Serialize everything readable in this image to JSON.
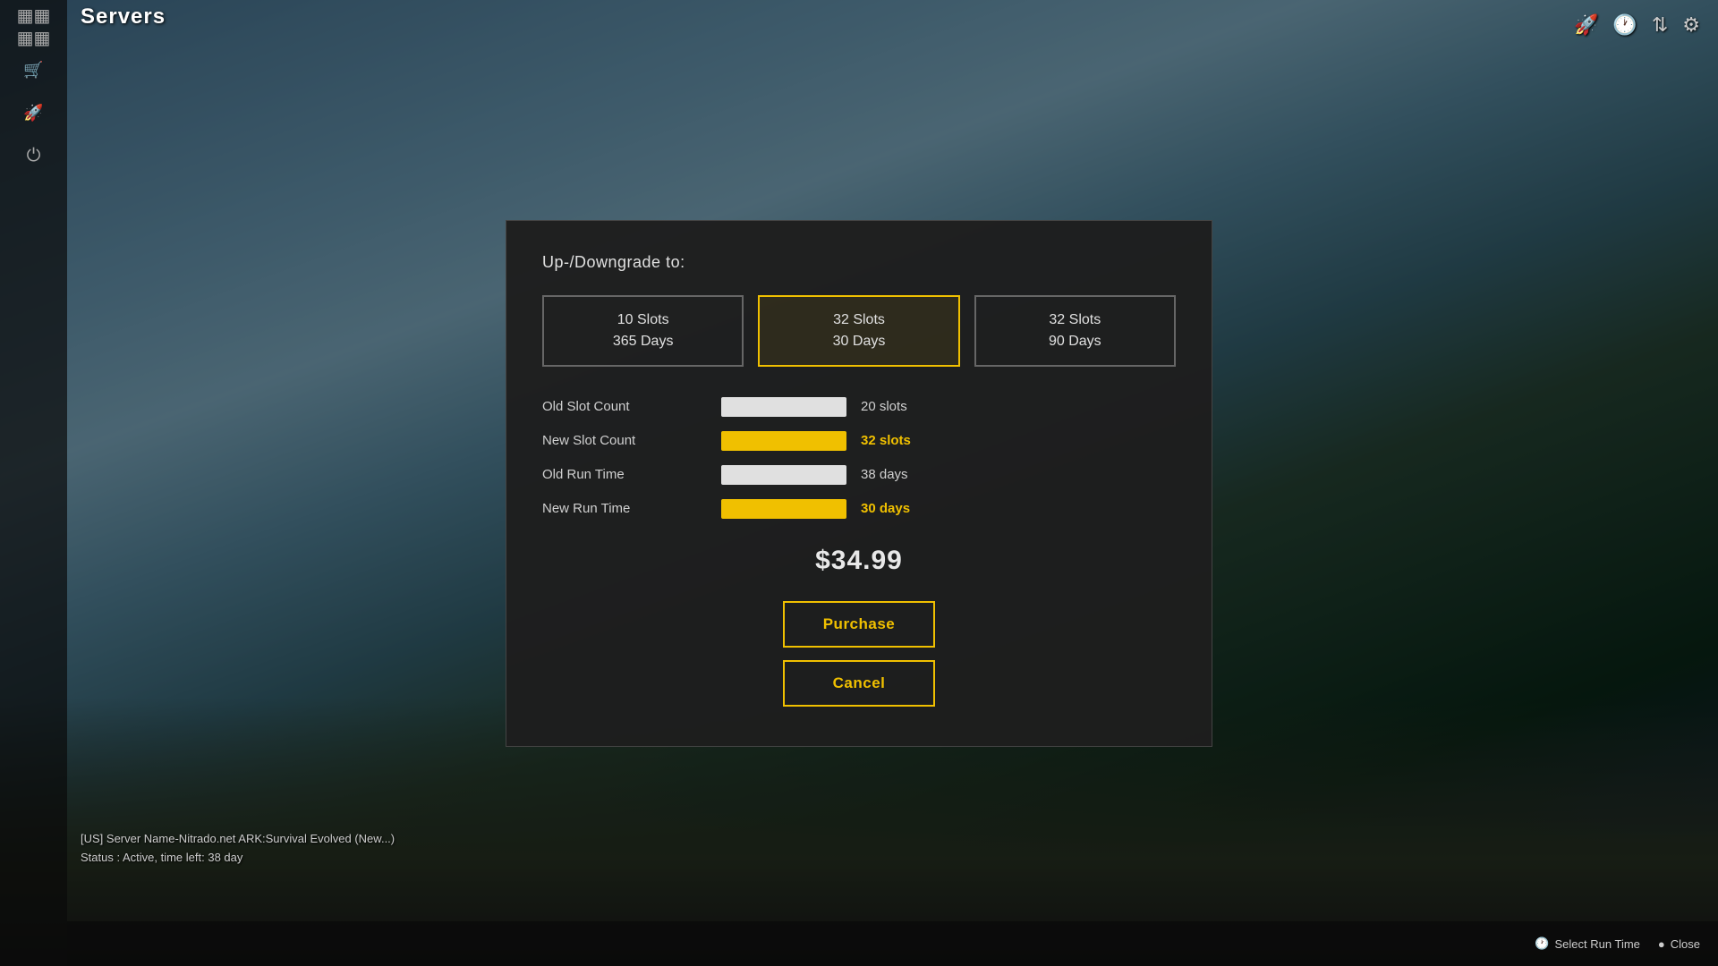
{
  "page": {
    "title": "Servers",
    "bg_color_top": "#6a9fbe",
    "bg_color_bottom": "#1a1a1a"
  },
  "sidebar": {
    "items": [
      {
        "id": "servers",
        "icon": "servers-icon",
        "label": "Servers"
      },
      {
        "id": "cart",
        "icon": "cart-icon",
        "label": "Shop"
      },
      {
        "id": "rocket",
        "icon": "rocket-icon",
        "label": "Boost"
      },
      {
        "id": "power",
        "icon": "power-icon",
        "label": "Power"
      }
    ]
  },
  "server_info": {
    "name": "[US] Server Name-Nitrado.net ARK:Survival Evolved (New...)",
    "status": "Status : Active, time left: 38 day"
  },
  "top_right": {
    "icons": [
      "rocket-icon",
      "clock-icon",
      "sort-icon",
      "gear-icon"
    ]
  },
  "bottom_bar": {
    "items": [
      {
        "label": "Select Run Time",
        "icon": "clock-icon"
      },
      {
        "label": "Close",
        "icon": "close-icon"
      }
    ]
  },
  "modal": {
    "section_title": "Up-/Downgrade to:",
    "slot_options": [
      {
        "id": "opt1",
        "line1": "10 Slots",
        "line2": "365 Days",
        "selected": false
      },
      {
        "id": "opt2",
        "line1": "32 Slots",
        "line2": "30 Days",
        "selected": true
      },
      {
        "id": "opt3",
        "line1": "32 Slots",
        "line2": "90 Days",
        "selected": false
      }
    ],
    "details": {
      "old_slot_label": "Old Slot Count",
      "old_slot_value": "20 slots",
      "new_slot_label": "New Slot Count",
      "new_slot_value": "32 slots",
      "old_runtime_label": "Old Run Time",
      "old_runtime_value": "38 days",
      "new_runtime_label": "New Run Time",
      "new_runtime_value": "30 days"
    },
    "price": "$34.99",
    "purchase_label": "Purchase",
    "cancel_label": "Cancel"
  }
}
